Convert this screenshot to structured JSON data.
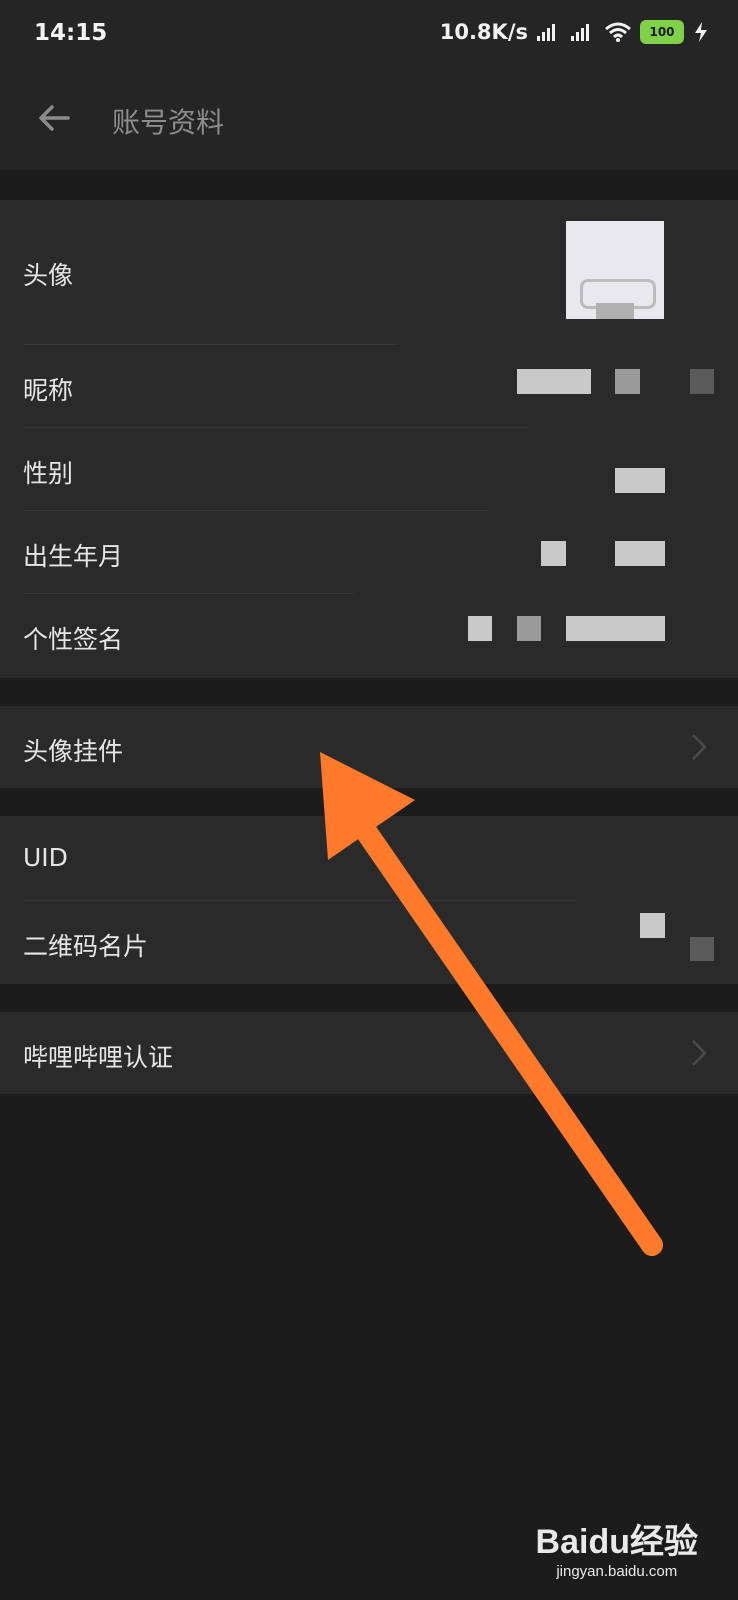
{
  "status_bar": {
    "time": "14:15",
    "network_speed": "10.8K/s",
    "battery": "100"
  },
  "toolbar": {
    "title": "账号资料"
  },
  "profile": {
    "avatar_label": "头像",
    "nickname_label": "昵称",
    "gender_label": "性别",
    "birth_label": "出生年月",
    "signature_label": "个性签名"
  },
  "pendant": {
    "label": "头像挂件"
  },
  "account": {
    "uid_label": "UID",
    "qrcode_label": "二维码名片"
  },
  "verify": {
    "label": "哔哩哔哩认证"
  },
  "watermark": {
    "brand": "Baidu经验",
    "url": "jingyan.baidu.com"
  },
  "colors": {
    "annotation_arrow": "#ff7a2a",
    "background": "#1c1c1c",
    "card": "#2a2a2a"
  }
}
